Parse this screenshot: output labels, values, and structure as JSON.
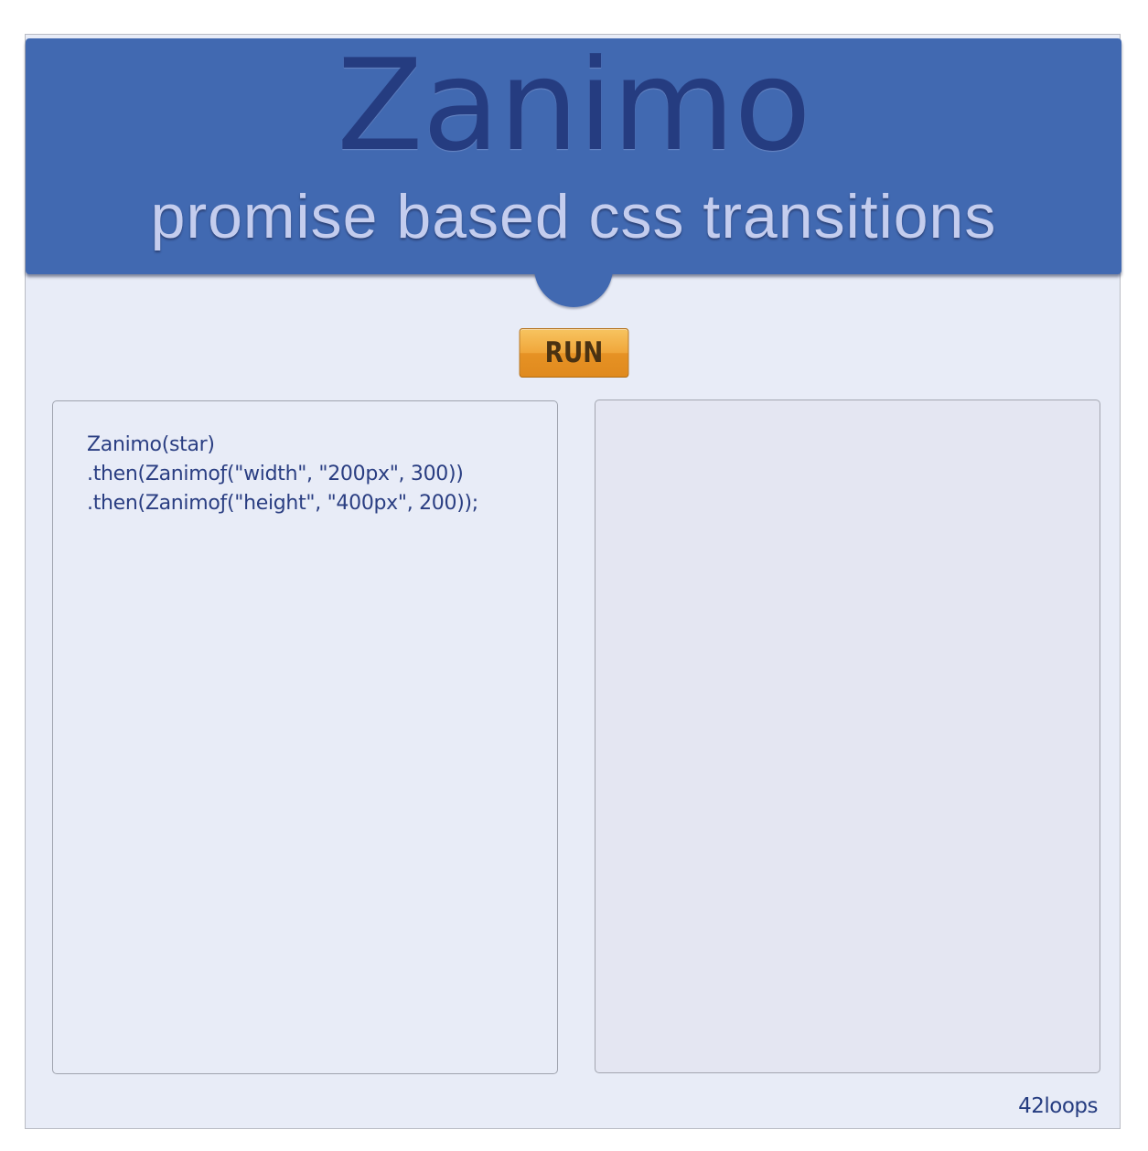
{
  "header": {
    "title": "Zanimo",
    "subtitle": "promise based css transitions"
  },
  "controls": {
    "run_label": "RUN"
  },
  "code": {
    "lines": [
      "Zanimo(star)",
      ".then(Zanimoƒ(\"width\", \"200px\", 300))",
      ".then(Zanimoƒ(\"height\", \"400px\", 200));"
    ]
  },
  "footer": {
    "credit": "42loops"
  },
  "colors": {
    "header_background": "#4169b1",
    "title": "#253c80",
    "subtitle": "#c4cdee",
    "page_background": "#e8ecf7",
    "stage_background": "#e4e6f2",
    "run_button": "#f0a63a"
  }
}
